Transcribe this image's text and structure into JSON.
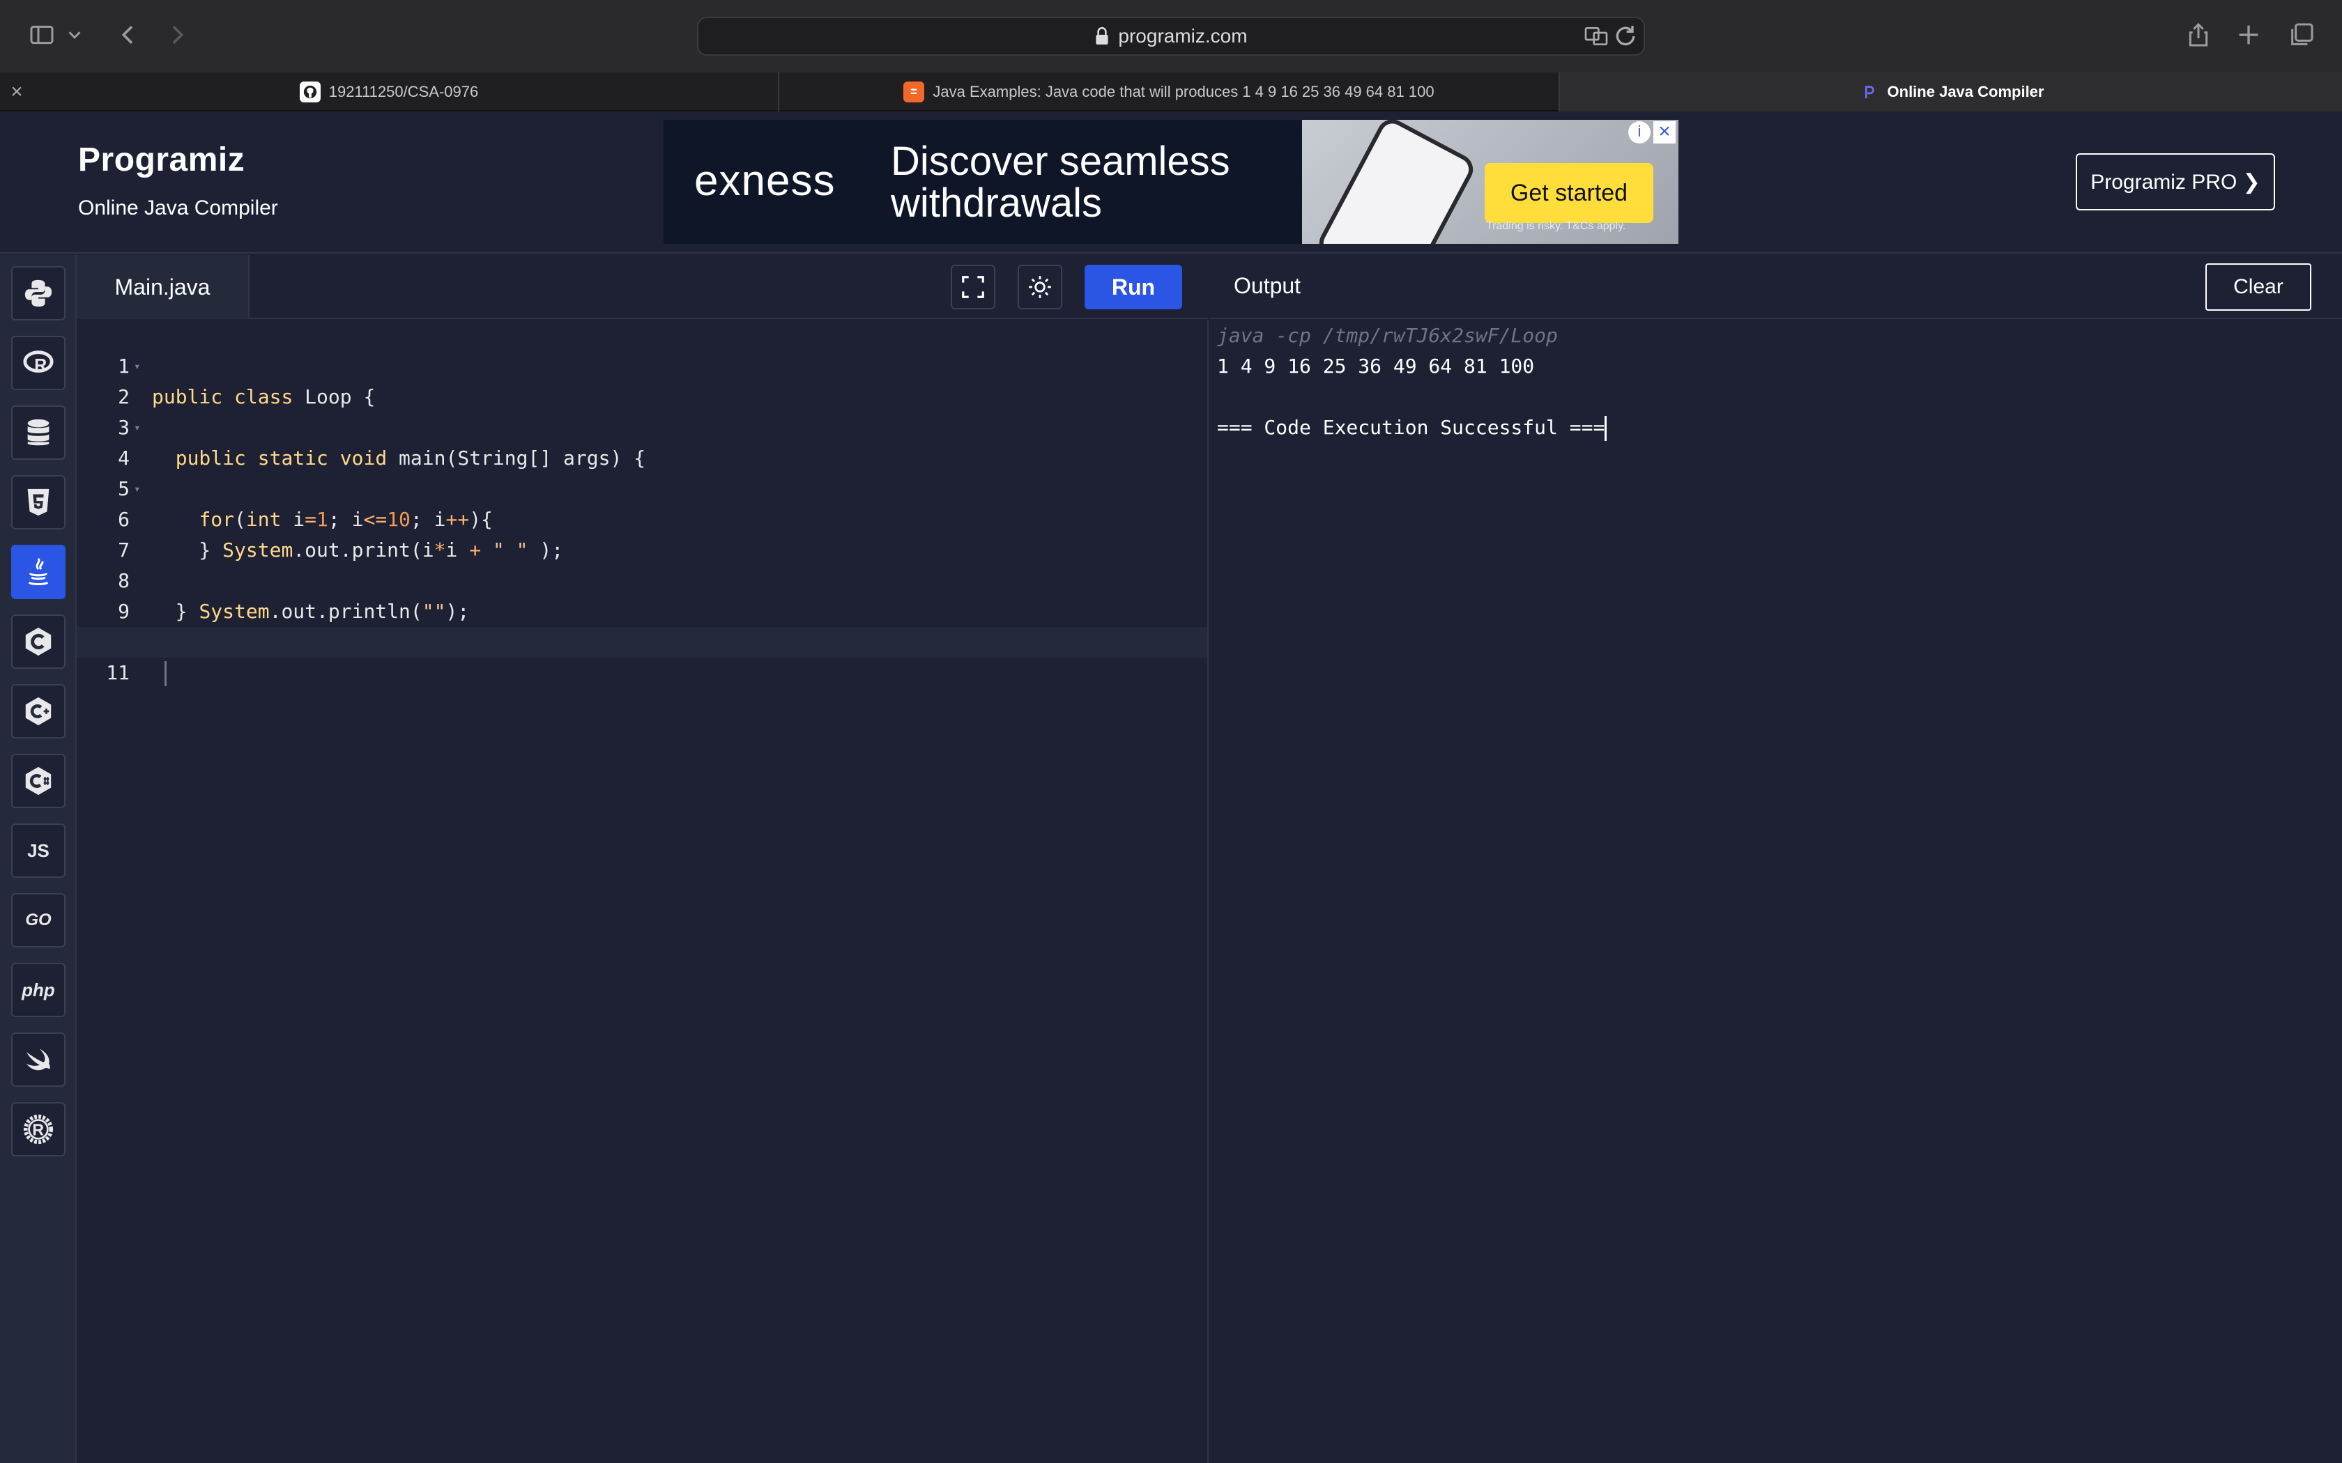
{
  "browser": {
    "url": "programiz.com",
    "tabs": [
      {
        "label": "192111250/CSA-0976",
        "icon": "github-icon"
      },
      {
        "label": "Java Examples: Java code that will produces 1 4 9 16 25 36 49 64 81 100",
        "icon": "blogger-icon"
      },
      {
        "label": "Online Java Compiler",
        "icon": "programiz-icon"
      }
    ]
  },
  "header": {
    "logo": "Programiz",
    "subtitle": "Online Java Compiler",
    "pro_button": "Programiz PRO ❯"
  },
  "ad": {
    "brand": "exness",
    "headline_1": "Discover seamless",
    "headline_2": "withdrawals",
    "cta": "Get started",
    "disclaimer": "Trading is risky. T&Cs apply."
  },
  "sidebar": {
    "languages": [
      {
        "name": "python",
        "icon": "python-icon",
        "active": false
      },
      {
        "name": "r",
        "icon": "r-icon",
        "active": false
      },
      {
        "name": "sql",
        "icon": "database-icon",
        "active": false
      },
      {
        "name": "html",
        "icon": "html5-icon",
        "active": false
      },
      {
        "name": "java",
        "icon": "java-icon",
        "active": true
      },
      {
        "name": "c",
        "icon": "c-icon",
        "active": false
      },
      {
        "name": "cpp",
        "icon": "cpp-icon",
        "active": false
      },
      {
        "name": "csharp",
        "icon": "csharp-icon",
        "active": false
      },
      {
        "name": "javascript",
        "label": "JS",
        "active": false
      },
      {
        "name": "go",
        "label": "GO",
        "active": false
      },
      {
        "name": "php",
        "label": "php",
        "active": false
      },
      {
        "name": "swift",
        "icon": "swift-icon",
        "active": false
      },
      {
        "name": "rust",
        "icon": "rust-icon",
        "active": false
      }
    ]
  },
  "editor": {
    "filename": "Main.java",
    "run_label": "Run",
    "lines": [
      "public class Loop {",
      "",
      "  public static void main(String[] args) {",
      "",
      "    for(int i=1; i<=10; i++){",
      "      System.out.print(i*i + \" \" );",
      "    }",
      "    System.out.println(\"\");",
      "  }",
      "}",
      ""
    ]
  },
  "output": {
    "title": "Output",
    "clear_label": "Clear",
    "command": "java -cp /tmp/rwTJ6x2swF/Loop",
    "result": "1 4 9 16 25 36 49 64 81 100",
    "status": "=== Code Execution Successful ==="
  },
  "colors": {
    "accent": "#2a55e5",
    "background": "#1d2133",
    "keyword": "#ffd98a",
    "number": "#f29b54"
  }
}
